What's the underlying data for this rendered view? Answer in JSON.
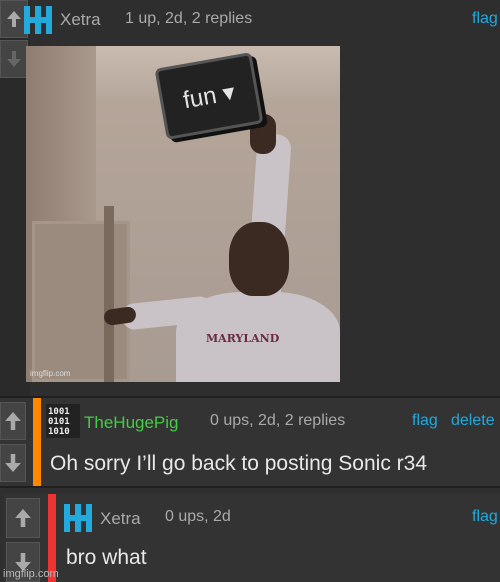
{
  "comments": [
    {
      "username": "Xetra",
      "meta": "1 up, 2d, 2 replies",
      "actions": [
        "flag"
      ],
      "accent_color": "#888888",
      "username_color": "#aaaaaa",
      "meme": {
        "sign_text": "fun ▾",
        "shirt_text": "MARYLAND",
        "watermark": "imgflip.com"
      }
    },
    {
      "username": "TheHugePig",
      "meta": "0 ups, 2d, 2 replies",
      "actions": [
        "flag",
        "delete"
      ],
      "accent_color": "#ff8800",
      "username_color": "#44cc44",
      "text": "Oh sorry I’ll go back to posting Sonic r34"
    },
    {
      "username": "Xetra",
      "meta": "0 ups, 2d",
      "actions": [
        "flag"
      ],
      "accent_color": "#ee3333",
      "username_color": "#aaaaaa",
      "text": "bro what"
    }
  ],
  "icons": {
    "upvote": "arrow-up-icon",
    "downvote": "arrow-down-icon",
    "xetra_avatar": "cyan-h-logo-icon",
    "pig_avatar": "binary-grid-icon"
  },
  "colors": {
    "link": "#22aadd",
    "background": "#2f2f2f"
  },
  "watermark": "imgflip.com"
}
